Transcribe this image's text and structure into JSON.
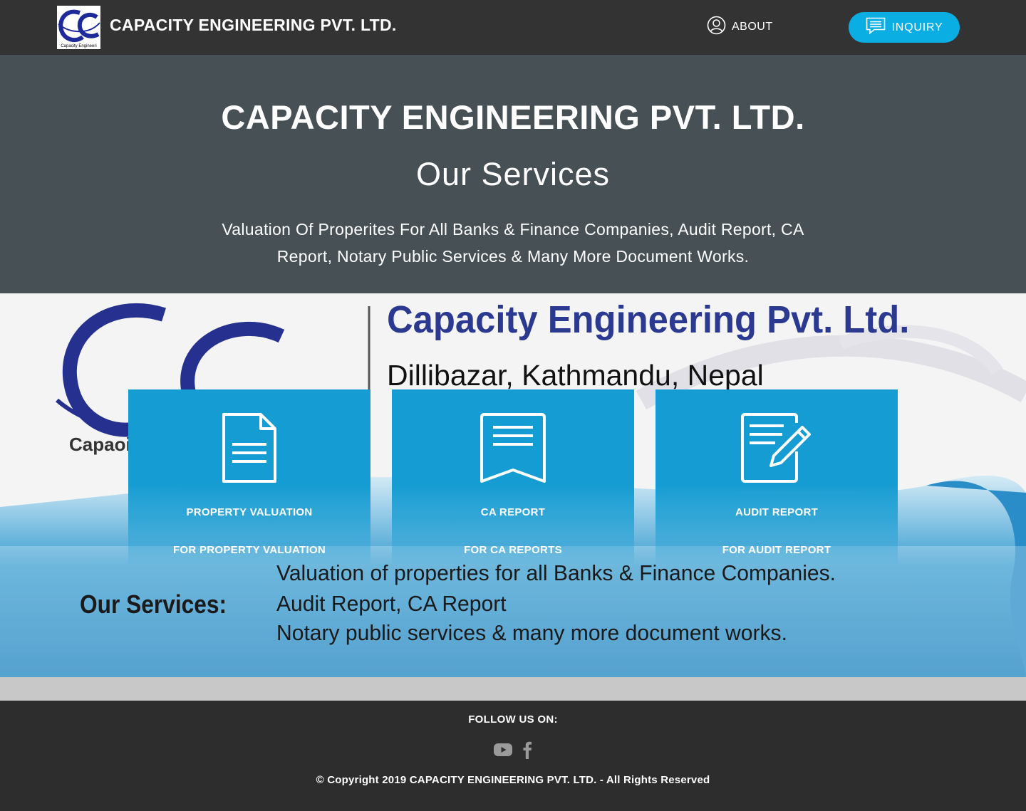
{
  "header": {
    "logo_text": "Capacity Engineeri",
    "brand": "CAPACITY ENGINEERING PVT. LTD.",
    "nav": {
      "about_label": "ABOUT",
      "about_icon": "user-circle-icon",
      "inquiry_label": "INQUIRY",
      "inquiry_icon": "message-icon"
    }
  },
  "hero": {
    "title": "CAPACITY ENGINEERING PVT. LTD.",
    "subtitle": "Our Services",
    "description": "Valuation Of Properites For All Banks & Finance Companies, Audit Report, CA Report, Notary Public Services & Many More Document Works."
  },
  "banner": {
    "company": "Capacity Engineering Pvt. Ltd.",
    "address": "Dillibazar, Kathmandu, Nepal",
    "logo_label": "Capaoit",
    "services_heading": "Our Services:",
    "services_lines": [
      "Valuation of properties for all Banks & Finance Companies.",
      "Audit Report, CA Report",
      "Notary public services & many more document works."
    ]
  },
  "services": [
    {
      "icon": "document-icon",
      "title": "PROPERTY VALUATION",
      "caption": "FOR PROPERTY VALUATION"
    },
    {
      "icon": "bookmark-list-icon",
      "title": "CA REPORT",
      "caption": "FOR CA REPORTS"
    },
    {
      "icon": "edit-document-icon",
      "title": "AUDIT REPORT",
      "caption": "FOR AUDIT REPORT"
    }
  ],
  "footer": {
    "follow_label": "FOLLOW US ON:",
    "social": [
      "youtube-icon",
      "facebook-icon"
    ],
    "copyright": "© Copyright 2019 CAPACITY ENGINEERING PVT. LTD. - All Rights Reserved"
  },
  "colors": {
    "topbar": "#333333",
    "hero_bg": "#465055",
    "accent": "#0aaee3",
    "card": "#159cd2",
    "footer": "#2d2d2d"
  }
}
